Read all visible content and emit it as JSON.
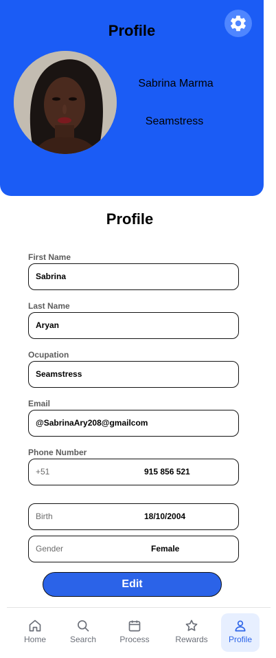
{
  "header": {
    "title": "Profile",
    "name": "Sabrina Marma",
    "occupation": "Seamstress"
  },
  "form": {
    "title": "Profile",
    "first_name": {
      "label": "First Name",
      "value": "Sabrina"
    },
    "last_name": {
      "label": "Last Name",
      "value": "Aryan"
    },
    "occupation": {
      "label": "Ocupation",
      "value": "Seamstress"
    },
    "email": {
      "label": "Email",
      "value": "@SabrinaAry208@gmailcom"
    },
    "phone": {
      "label": "Phone Number",
      "prefix": "+51",
      "value": "915 856 521"
    },
    "birth": {
      "label": "Birth",
      "value": "18/10/2004"
    },
    "gender": {
      "label": "Gender",
      "value": "Female"
    },
    "edit_label": "Edit"
  },
  "nav": {
    "items": [
      {
        "label": "Home",
        "icon": "home-icon"
      },
      {
        "label": "Search",
        "icon": "search-icon"
      },
      {
        "label": "Process",
        "icon": "calendar-icon"
      },
      {
        "label": "Rewards",
        "icon": "star-icon"
      },
      {
        "label": "Profile",
        "icon": "user-icon"
      }
    ],
    "active": "Profile"
  },
  "colors": {
    "header_bg": "#1b5cf5",
    "button_bg": "#2b63e8",
    "active_nav_bg": "#e7efff"
  }
}
